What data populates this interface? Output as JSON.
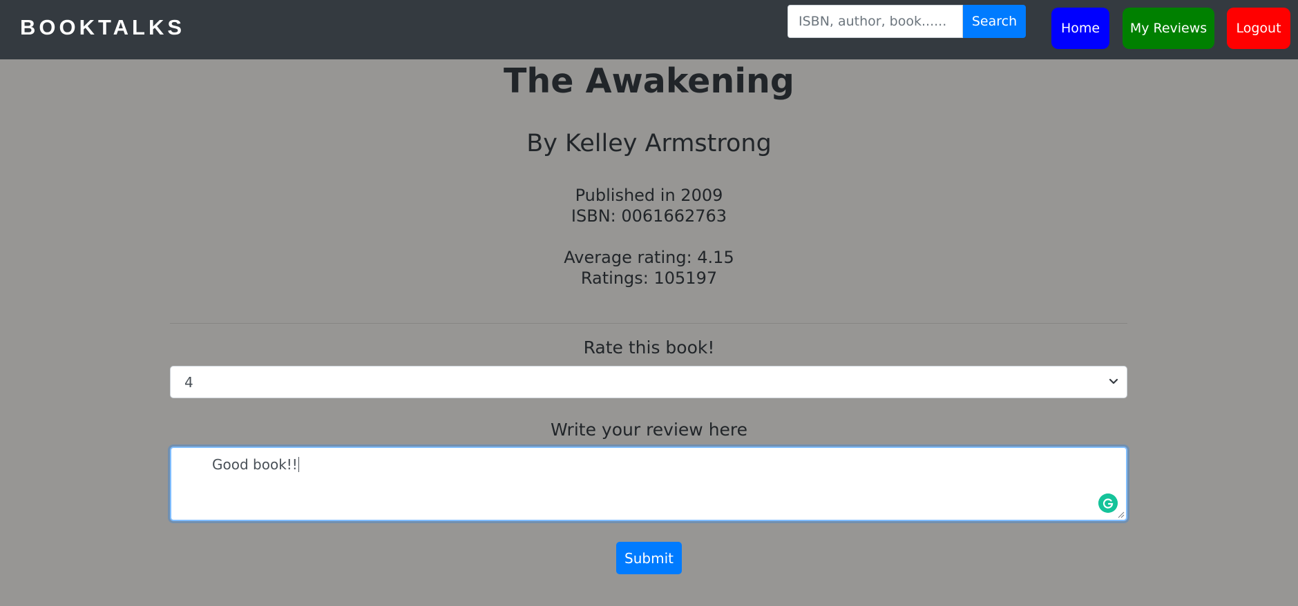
{
  "navbar": {
    "brand": "BOOKTALKS",
    "search_placeholder": "ISBN, author, book......",
    "search_label": "Search",
    "home_label": "Home",
    "reviews_label": "My Reviews",
    "logout_label": "Logout",
    "colors": {
      "background": "#343a40",
      "search": "#007bff",
      "home": "#0000ff",
      "reviews": "#008000",
      "logout": "#ff0000"
    }
  },
  "book": {
    "title": "The Awakening",
    "author": "By Kelley Armstrong",
    "published": "Published in 2009",
    "isbn": "ISBN: 0061662763",
    "average_rating": "Average rating: 4.15",
    "ratings": "Ratings: 105197"
  },
  "review_form": {
    "rate_label": "Rate this book!",
    "rating_value": "4",
    "review_label": "Write your review here",
    "review_text": "Good book!!",
    "submit_label": "Submit",
    "icons": {
      "select": "chevron-down-icon",
      "grammarly": "grammarly-icon",
      "resize": "resize-handle-icon"
    }
  },
  "page": {
    "background": "#979694"
  }
}
